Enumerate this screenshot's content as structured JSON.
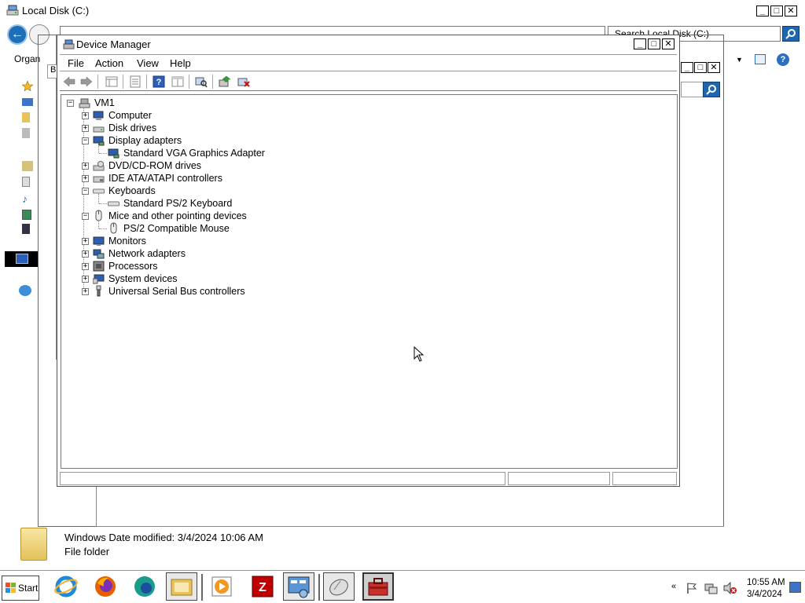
{
  "explorer": {
    "title": "Local Disk (C:)",
    "search_placeholder": "Search Local Disk (C:)",
    "organize_label": "Organ",
    "details": {
      "name_and_date": "Windows Date modified: 3/4/2024 10:06 AM",
      "type": "File folder"
    }
  },
  "third_window": {
    "tab_label": "B"
  },
  "device_manager": {
    "title": "Device Manager",
    "menu": [
      "File",
      "Action",
      "View",
      "Help"
    ],
    "toolbar": [
      "back-icon",
      "forward-icon",
      "up-icon",
      "properties-icon",
      "help-icon",
      "show-hide-icon",
      "scan-hardware-icon",
      "update-driver-icon",
      "uninstall-icon"
    ],
    "tree": {
      "root": "VM1",
      "nodes": [
        {
          "label": "Computer",
          "expanded": false,
          "icon": "computer-icon"
        },
        {
          "label": "Disk drives",
          "expanded": false,
          "icon": "disk-drive-icon"
        },
        {
          "label": "Display adapters",
          "expanded": true,
          "icon": "display-adapter-icon",
          "children": [
            "Standard VGA Graphics Adapter"
          ]
        },
        {
          "label": "DVD/CD-ROM drives",
          "expanded": false,
          "icon": "dvd-drive-icon"
        },
        {
          "label": "IDE ATA/ATAPI controllers",
          "expanded": false,
          "icon": "ide-controller-icon"
        },
        {
          "label": "Keyboards",
          "expanded": true,
          "icon": "keyboard-icon",
          "children": [
            "Standard PS/2 Keyboard"
          ]
        },
        {
          "label": "Mice and other pointing devices",
          "expanded": true,
          "icon": "mouse-icon",
          "children": [
            "PS/2 Compatible Mouse"
          ]
        },
        {
          "label": "Monitors",
          "expanded": false,
          "icon": "monitor-icon"
        },
        {
          "label": "Network adapters",
          "expanded": false,
          "icon": "network-adapter-icon"
        },
        {
          "label": "Processors",
          "expanded": false,
          "icon": "processor-icon"
        },
        {
          "label": "System devices",
          "expanded": false,
          "icon": "system-devices-icon"
        },
        {
          "label": "Universal Serial Bus controllers",
          "expanded": false,
          "icon": "usb-icon"
        }
      ]
    }
  },
  "taskbar": {
    "start_label": "Start",
    "apps": [
      "internet-explorer-icon",
      "firefox-icon",
      "edge-icon",
      "explorer-icon",
      "media-player-icon",
      "filezilla-icon",
      "control-panel-icon",
      "mouse-settings-icon",
      "toolbox-icon"
    ],
    "clock_time": "10:55 AM",
    "clock_date": "3/4/2024",
    "tray_chevron": "«"
  }
}
